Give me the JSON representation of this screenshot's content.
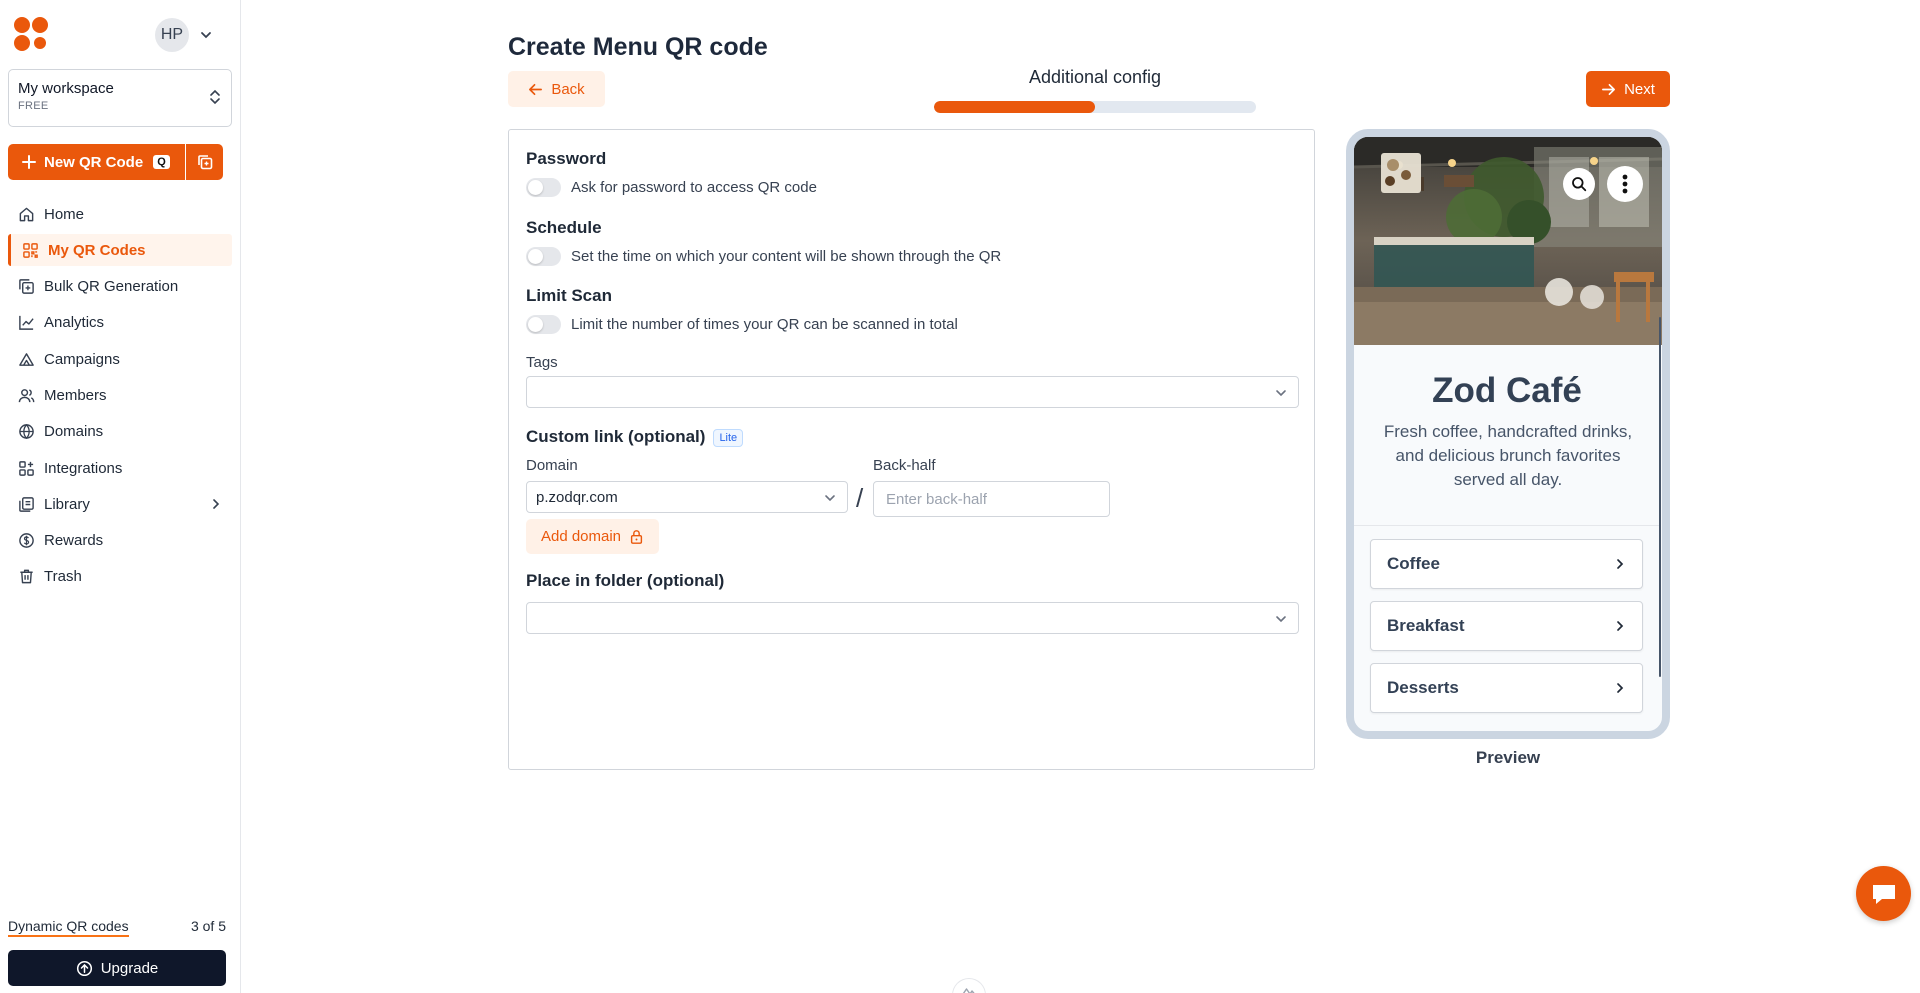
{
  "sidebar": {
    "user_initials": "HP",
    "workspace_name": "My workspace",
    "workspace_plan": "FREE",
    "new_qr_label": "New QR Code",
    "new_qr_shortcut": "Q",
    "nav": [
      {
        "label": "Home",
        "icon": "home-icon"
      },
      {
        "label": "My QR Codes",
        "icon": "qr-grid-icon",
        "active": true
      },
      {
        "label": "Bulk QR Generation",
        "icon": "bulk-copy-icon"
      },
      {
        "label": "Analytics",
        "icon": "chart-icon"
      },
      {
        "label": "Campaigns",
        "icon": "campaign-icon"
      },
      {
        "label": "Members",
        "icon": "users-icon"
      },
      {
        "label": "Domains",
        "icon": "globe-icon"
      },
      {
        "label": "Integrations",
        "icon": "integrations-icon"
      },
      {
        "label": "Library",
        "icon": "library-icon"
      },
      {
        "label": "Rewards",
        "icon": "rewards-icon"
      },
      {
        "label": "Trash",
        "icon": "trash-icon"
      }
    ],
    "usage_label": "Dynamic QR codes",
    "usage_count": "3 of 5",
    "usage_fraction": 0.6,
    "upgrade_label": "Upgrade"
  },
  "header": {
    "title": "Create Menu QR code",
    "back_label": "Back",
    "step_label": "Additional config",
    "step_progress": 0.5,
    "next_label": "Next"
  },
  "form": {
    "password": {
      "title": "Password",
      "toggle_label": "Ask for password to access QR code",
      "enabled": false
    },
    "schedule": {
      "title": "Schedule",
      "toggle_label": "Set the time on which your content will be shown through the QR",
      "enabled": false
    },
    "limit_scan": {
      "title": "Limit Scan",
      "toggle_label": "Limit the number of times your QR can be scanned in total",
      "enabled": false
    },
    "tags_label": "Tags",
    "tags_value": "",
    "custom_link": {
      "title": "Custom link (optional)",
      "badge": "Lite",
      "domain_label": "Domain",
      "domain_value": "p.zodqr.com",
      "separator": "/",
      "backhalf_label": "Back-half",
      "backhalf_placeholder": "Enter back-half",
      "add_domain_label": "Add domain"
    },
    "folder_label": "Place in folder (optional)",
    "folder_value": ""
  },
  "preview": {
    "cafe_name": "Zod Café",
    "description": "Fresh coffee, handcrafted drinks, and delicious brunch favorites served all day.",
    "menu_items": [
      "Coffee",
      "Breakfast",
      "Desserts"
    ],
    "label": "Preview"
  },
  "colors": {
    "accent": "#ea580c",
    "accent_soft": "#fff1e7",
    "dark": "#0f172a"
  }
}
